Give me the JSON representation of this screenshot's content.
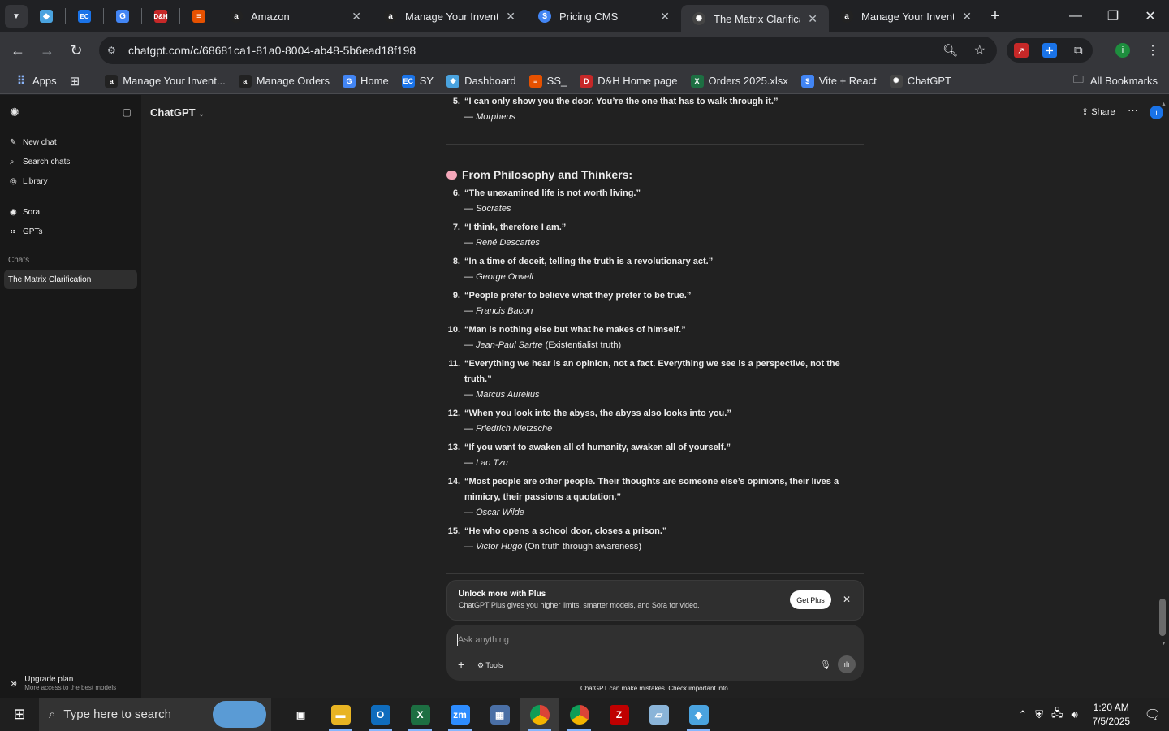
{
  "browser": {
    "tabs": [
      {
        "title": "Amazon",
        "icon": "amazon-icon"
      },
      {
        "title": "Manage Your Inventor",
        "icon": "amazon-icon"
      },
      {
        "title": "Pricing CMS",
        "icon": "dollar-icon"
      },
      {
        "title": "The Matrix Clarificatio",
        "icon": "chatgpt-icon",
        "active": true
      },
      {
        "title": "Manage Your Inventor",
        "icon": "amazon-icon"
      }
    ],
    "pinned": [
      {
        "icon": "hexagon-app-icon",
        "glyph": "◆",
        "color": "#4aa3df"
      },
      {
        "icon": "ec-icon",
        "glyph": "EC",
        "color": "#1a73e8"
      },
      {
        "icon": "doc-icon",
        "glyph": "G",
        "color": "#4285f4"
      },
      {
        "icon": "dh-icon",
        "glyph": "D&H",
        "color": "#c62828"
      },
      {
        "icon": "layers-icon",
        "glyph": "≡",
        "color": "#e65100"
      }
    ],
    "url": "chatgpt.com/c/68681ca1-81a0-8004-ab48-5b6ead18f198",
    "bookmarks": [
      {
        "label": "Apps",
        "icon": "apps-grid-icon"
      },
      {
        "label": "Manage Your Invent...",
        "icon": "amazon-icon"
      },
      {
        "label": "Manage Orders",
        "icon": "amazon-icon"
      },
      {
        "label": "Home",
        "icon": "g-icon"
      },
      {
        "label": "SY",
        "icon": "ec-icon"
      },
      {
        "label": "Dashboard",
        "icon": "hexagon-app-icon"
      },
      {
        "label": "SS_",
        "icon": "layers-icon"
      },
      {
        "label": "D&H Home page",
        "icon": "dh-icon"
      },
      {
        "label": "Orders 2025.xlsx",
        "icon": "excel-icon"
      },
      {
        "label": "Vite + React",
        "icon": "dollar-icon"
      },
      {
        "label": "ChatGPT",
        "icon": "chatgpt-icon"
      }
    ],
    "all_bookmarks": "All Bookmarks"
  },
  "sidebar": {
    "items": [
      {
        "label": "New chat",
        "icon": "edit-icon"
      },
      {
        "label": "Search chats",
        "icon": "search-icon"
      },
      {
        "label": "Library",
        "icon": "library-icon"
      }
    ],
    "apps": [
      {
        "label": "Sora",
        "icon": "sora-icon"
      },
      {
        "label": "GPTs",
        "icon": "gpts-icon"
      }
    ],
    "chats_heading": "Chats",
    "active_chat": "The Matrix Clarification",
    "upgrade_title": "Upgrade plan",
    "upgrade_sub": "More access to the best models"
  },
  "header": {
    "model": "ChatGPT",
    "share": "Share",
    "avatar": "i"
  },
  "content": {
    "top_quote": {
      "num": "5.",
      "text": "“I can only show you the door. You’re the one that has to walk through it.”",
      "author": "Morpheus",
      "note": ""
    },
    "heading": "From Philosophy and Thinkers:",
    "quotes": [
      {
        "num": "6.",
        "text": "“The unexamined life is not worth living.”",
        "author": "Socrates",
        "note": ""
      },
      {
        "num": "7.",
        "text": "“I think, therefore I am.”",
        "author": "René Descartes",
        "note": ""
      },
      {
        "num": "8.",
        "text": "“In a time of deceit, telling the truth is a revolutionary act.”",
        "author": "George Orwell",
        "note": ""
      },
      {
        "num": "9.",
        "text": "“People prefer to believe what they prefer to be true.”",
        "author": "Francis Bacon",
        "note": ""
      },
      {
        "num": "10.",
        "text": "“Man is nothing else but what he makes of himself.”",
        "author": "Jean-Paul Sartre",
        "note": " (Existentialist truth)"
      },
      {
        "num": "11.",
        "text": "“Everything we hear is an opinion, not a fact. Everything we see is a perspective, not the truth.”",
        "author": "Marcus Aurelius",
        "note": ""
      },
      {
        "num": "12.",
        "text": "“When you look into the abyss, the abyss also looks into you.”",
        "author": "Friedrich Nietzsche",
        "note": ""
      },
      {
        "num": "13.",
        "text": "“If you want to awaken all of humanity, awaken all of yourself.”",
        "author": "Lao Tzu",
        "note": ""
      },
      {
        "num": "14.",
        "text": "“Most people are other people. Their thoughts are someone else’s opinions, their lives a mimicry, their passions a quotation.”",
        "author": "Oscar Wilde",
        "note": ""
      },
      {
        "num": "15.",
        "text": "“He who opens a school door, closes a prison.”",
        "author": "Victor Hugo",
        "note": " (On truth through awareness)"
      }
    ]
  },
  "banner": {
    "title": "Unlock more with Plus",
    "subtitle": "ChatGPT Plus gives you higher limits, smarter models, and Sora for video.",
    "button": "Get Plus"
  },
  "composer": {
    "placeholder": "Ask anything",
    "tools": "Tools"
  },
  "disclaimer": "ChatGPT can make mistakes. Check important info.",
  "taskbar": {
    "search_placeholder": "Type here to search",
    "apps": [
      {
        "name": "task-view-icon",
        "glyph": "▣",
        "color": "transparent",
        "run": false
      },
      {
        "name": "file-explorer-icon",
        "glyph": "▬",
        "color": "#e8b423",
        "run": true
      },
      {
        "name": "outlook-icon",
        "glyph": "O",
        "color": "#0f6cbd",
        "run": true
      },
      {
        "name": "excel-icon",
        "glyph": "X",
        "color": "#1d6f42",
        "run": true
      },
      {
        "name": "zoom-icon",
        "glyph": "zm",
        "color": "#2d8cff",
        "run": true
      },
      {
        "name": "calculator-icon",
        "glyph": "▦",
        "color": "#4a6fa5",
        "run": false
      },
      {
        "name": "chrome-icon",
        "glyph": "●",
        "color": "#db4437",
        "run": true,
        "current": true
      },
      {
        "name": "chrome-profile-icon",
        "glyph": "●",
        "color": "#db4437",
        "run": true
      },
      {
        "name": "filezilla-icon",
        "glyph": "Z",
        "color": "#bf0000",
        "run": false
      },
      {
        "name": "notepad-icon",
        "glyph": "▱",
        "color": "#8ab4d8",
        "run": false
      },
      {
        "name": "hexagon-app-icon",
        "glyph": "◆",
        "color": "#4aa3df",
        "run": true
      }
    ],
    "time": "1:20 AM",
    "date": "7/5/2025"
  }
}
